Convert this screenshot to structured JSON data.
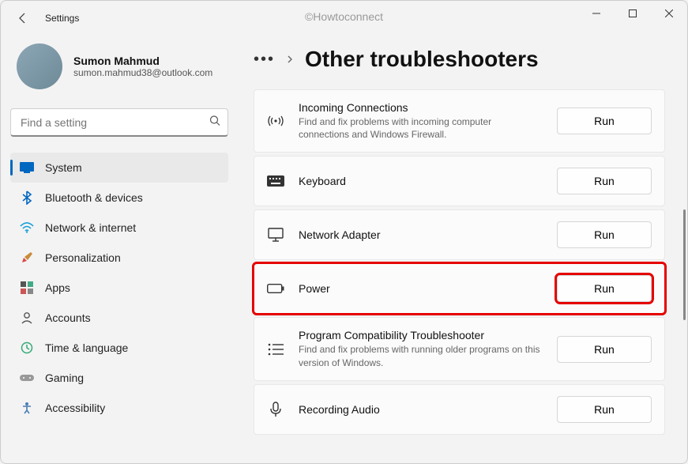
{
  "app": {
    "title": "Settings"
  },
  "watermark": "©Howtoconnect",
  "profile": {
    "name": "Sumon Mahmud",
    "email": "sumon.mahmud38@outlook.com"
  },
  "search": {
    "placeholder": "Find a setting"
  },
  "nav": {
    "items": [
      {
        "label": "System",
        "icon": "system-icon",
        "active": true
      },
      {
        "label": "Bluetooth & devices",
        "icon": "bluetooth-icon"
      },
      {
        "label": "Network & internet",
        "icon": "wifi-icon"
      },
      {
        "label": "Personalization",
        "icon": "personalization-icon"
      },
      {
        "label": "Apps",
        "icon": "apps-icon"
      },
      {
        "label": "Accounts",
        "icon": "accounts-icon"
      },
      {
        "label": "Time & language",
        "icon": "time-icon"
      },
      {
        "label": "Gaming",
        "icon": "gaming-icon"
      },
      {
        "label": "Accessibility",
        "icon": "accessibility-icon"
      }
    ]
  },
  "breadcrumb": {
    "title": "Other troubleshooters"
  },
  "troubleshooters": [
    {
      "title": "Incoming Connections",
      "desc": "Find and fix problems with incoming computer connections and Windows Firewall.",
      "icon": "broadcast-icon",
      "run": "Run"
    },
    {
      "title": "Keyboard",
      "desc": "",
      "icon": "keyboard-icon",
      "run": "Run"
    },
    {
      "title": "Network Adapter",
      "desc": "",
      "icon": "monitor-icon",
      "run": "Run"
    },
    {
      "title": "Power",
      "desc": "",
      "icon": "battery-icon",
      "run": "Run",
      "highlighted": true
    },
    {
      "title": "Program Compatibility Troubleshooter",
      "desc": "Find and fix problems with running older programs on this version of Windows.",
      "icon": "list-icon",
      "run": "Run"
    },
    {
      "title": "Recording Audio",
      "desc": "",
      "icon": "mic-icon",
      "run": "Run"
    }
  ]
}
